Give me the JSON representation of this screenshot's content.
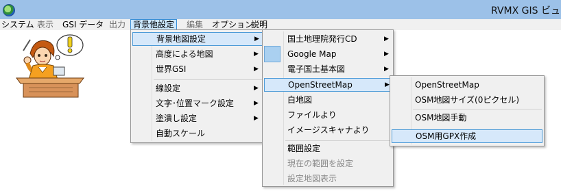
{
  "window": {
    "title": "RVMX GIS ビュ"
  },
  "menubar": {
    "items": [
      "システム",
      "表示",
      "GSI データ",
      "出力",
      "背景他設定",
      "編集",
      "オプション",
      "説明"
    ],
    "active": "背景他設定"
  },
  "menu1": {
    "items": [
      "背景地図設定",
      "高度による地図",
      "世界GSI",
      "線設定",
      "文字･位置マーク設定",
      "塗潰し設定",
      "自動スケール"
    ]
  },
  "menu2": {
    "items": [
      "国土地理院発行CD",
      "Google Map",
      "電子国土基本図",
      "OpenStreetMap",
      "白地図",
      "ファイルより",
      "イメージスキャナより",
      "範囲設定",
      "現在の範囲を設定",
      "設定地図表示"
    ]
  },
  "menu3": {
    "items": [
      "OpenStreetMap",
      "OSM地図サイズ(0ピクセル)",
      "OSM地図手動",
      "OSM用GPX作成"
    ]
  },
  "icons": {
    "app": "globe-icon",
    "submenu": "submenu-arrow-icon",
    "mascot": "mascot-illustration",
    "bubble": "exclamation-bubble-icon"
  }
}
